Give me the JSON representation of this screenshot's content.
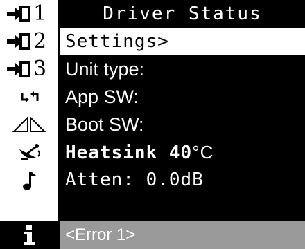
{
  "header": {
    "title": "Driver Status"
  },
  "menu": {
    "items": [
      {
        "icon": "enter-arrow-icon",
        "number": "1"
      },
      {
        "icon": "enter-arrow-icon",
        "number": "2"
      },
      {
        "icon": "enter-arrow-icon",
        "number": "3"
      }
    ]
  },
  "status_rows": {
    "settings": "Settings>",
    "unit_type": "Unit type:",
    "app_sw": "App SW:",
    "boot_sw": "Boot SW:",
    "heatsink_label": "Heatsink",
    "heatsink_value": "40",
    "heatsink_unit": "°C",
    "atten": "Atten: 0.0dB",
    "error": "<Error 1>"
  },
  "icons": {
    "app_sw": "swap-arrows-icon",
    "boot_sw": "mirror-triangles-icon",
    "heatsink": "satellite-dish-icon",
    "atten": "music-note-icon",
    "error": "info-icon"
  },
  "colors": {
    "background": "#000000",
    "icon_column": "#ffffff",
    "selected_row": "#ffffff",
    "status_bar": "#9a9a9a",
    "text": "#ffffff"
  }
}
